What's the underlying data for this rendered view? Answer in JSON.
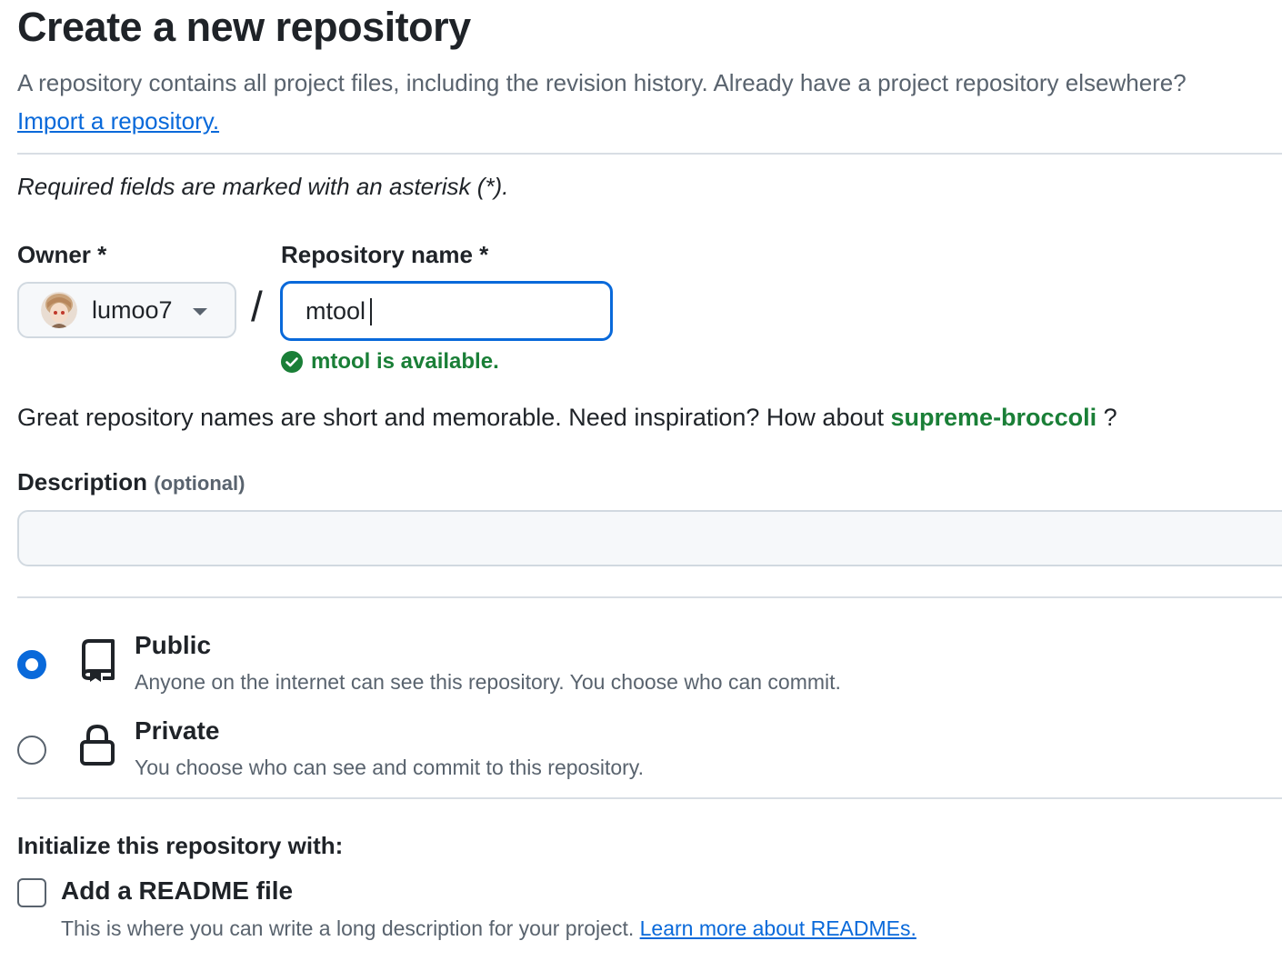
{
  "header": {
    "title": "Create a new repository",
    "intro_text": "A repository contains all project files, including the revision history. Already have a project repository elsewhere?",
    "import_link": "Import a repository."
  },
  "form": {
    "required_note": "Required fields are marked with an asterisk (*).",
    "owner": {
      "label": "Owner *",
      "value": "lumoo7"
    },
    "separator": "/",
    "repo_name": {
      "label": "Repository name *",
      "value": "mtool",
      "availability": "mtool is available."
    },
    "suggestion": {
      "text": "Great repository names are short and memorable. Need inspiration? How about",
      "name": "supreme-broccoli",
      "suffix": "?"
    },
    "description": {
      "label": "Description",
      "optional": "(optional)",
      "value": "",
      "placeholder": ""
    },
    "visibility": {
      "selected": "public",
      "public": {
        "title": "Public",
        "description": "Anyone on the internet can see this repository. You choose who can commit."
      },
      "private": {
        "title": "Private",
        "description": "You choose who can see and commit to this repository."
      }
    },
    "initialize": {
      "title": "Initialize this repository with:",
      "readme": {
        "label": "Add a README file",
        "description": "This is where you can write a long description for your project.",
        "link": "Learn more about READMEs.",
        "checked": false
      }
    }
  },
  "colors": {
    "accent": "#0969da",
    "success": "#1a7f37",
    "text": "#1f2328",
    "muted": "#59636e",
    "border": "#d1d9e0"
  }
}
